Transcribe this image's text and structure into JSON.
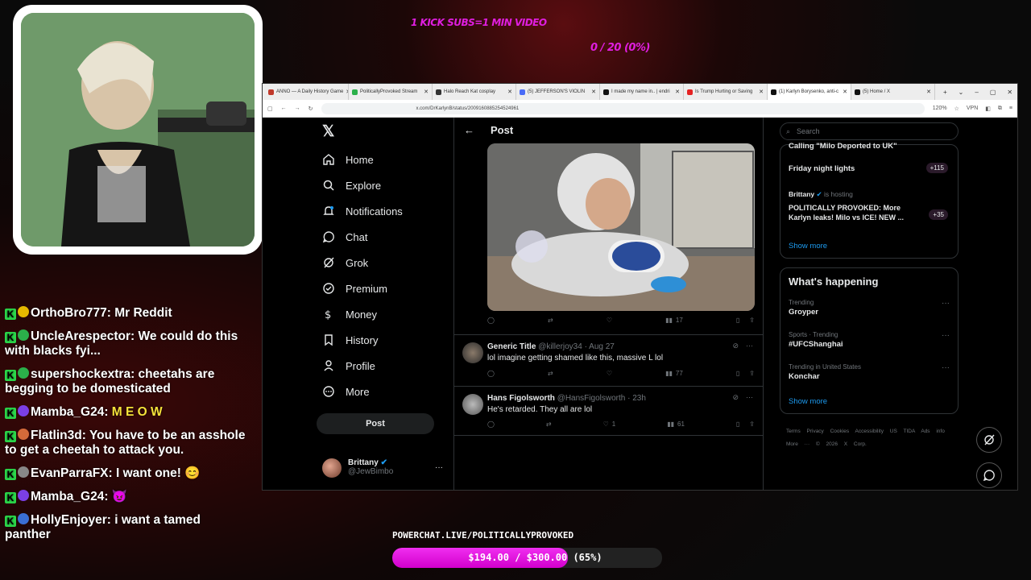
{
  "overlay": {
    "kick_subs": "1 KICK SUBS=1 MIN VIDEO",
    "sub_progress": "0 / 20 (0%)",
    "powerchat_label": "POWERCHAT.LIVE/POLITICALLYPROVOKED",
    "goal_text": "$194.00 / $300.00 (65%)",
    "goal_fraction": 0.65
  },
  "chat": [
    {
      "user": "OrthoBro777",
      "text": "Mr Reddit",
      "badge_color": "#e6b800"
    },
    {
      "user": "UncleArespector",
      "text": "We could do this with blacks fyi...",
      "badge_color": "#2bb04a"
    },
    {
      "user": "supershockextra",
      "text": "cheetahs are begging to be domesticated",
      "badge_color": "#2bb04a"
    },
    {
      "user": "Mamba_G24",
      "text": "M E O W",
      "badge_color": "#7b3fe4"
    },
    {
      "user": "Flatlin3d",
      "text": "You have to be an asshole to get a cheetah to attack you.",
      "badge_color": "#d46a3a"
    },
    {
      "user": "EvanParraFX",
      "text": "I want one! 😊",
      "badge_color": "#888888"
    },
    {
      "user": "Mamba_G24",
      "text": "😈",
      "badge_color": "#7b3fe4"
    },
    {
      "user": "HollyEnjoyer",
      "text": "i want a tamed panther",
      "badge_color": "#3a6fd4"
    }
  ],
  "browser": {
    "tabs": [
      {
        "label": "ANNO — A Daily History Game",
        "color": "#c0392b"
      },
      {
        "label": "PoliticallyProvoked Stream",
        "color": "#2bb04a"
      },
      {
        "label": "Halo Reach Kat cosplay",
        "color": "#333333"
      },
      {
        "label": "(5) JEFFERSON'S VIOLIN",
        "color": "#4a6cf7"
      },
      {
        "label": "I made my name in.. | endri",
        "color": "#111111"
      },
      {
        "label": "Is Trump Hurting or Saving",
        "color": "#e52222"
      },
      {
        "label": "(1) Karlyn Borysenko, anti-c",
        "color": "#111111"
      },
      {
        "label": "(5) Home / X",
        "color": "#111111"
      }
    ],
    "url": "x.com/DrKarlynB/status/2009160885254524961",
    "zoom": "120%",
    "vpn": "VPN"
  },
  "x": {
    "nav": [
      {
        "label": "Home",
        "icon": "home-icon"
      },
      {
        "label": "Explore",
        "icon": "search-icon"
      },
      {
        "label": "Notifications",
        "icon": "bell-icon"
      },
      {
        "label": "Chat",
        "icon": "chat-icon"
      },
      {
        "label": "Grok",
        "icon": "grok-icon"
      },
      {
        "label": "Premium",
        "icon": "premium-icon"
      },
      {
        "label": "Money",
        "icon": "money-icon"
      },
      {
        "label": "History",
        "icon": "bookmark-icon"
      },
      {
        "label": "Profile",
        "icon": "profile-icon"
      },
      {
        "label": "More",
        "icon": "more-icon"
      }
    ],
    "post_button": "Post",
    "account": {
      "name": "Brittany",
      "handle": "@JewBimbo"
    },
    "timeline_title": "Post",
    "media_actions": {
      "views": "17"
    },
    "replies": [
      {
        "name": "Generic Title",
        "handle": "@killerjoy34",
        "time": "· Aug 27",
        "text": "lol imagine getting shamed like this, massive L lol",
        "likes": "",
        "views": "77"
      },
      {
        "name": "Hans Figolsworth",
        "handle": "@HansFigolsworth",
        "time": "· 23h",
        "text": "He's retarded. They all are lol",
        "likes": "1",
        "views": "61"
      }
    ],
    "search_placeholder": "Search",
    "live": {
      "partial_title": "Calling \"Milo Deported to UK\"",
      "friday": "Friday night lights",
      "friday_count": "+115",
      "host_name": "Brittany",
      "host_status": "is hosting",
      "host_title": "POLITICALLY PROVOKED: More Karlyn leaks! Milo vs ICE! NEW ...",
      "host_count": "+35",
      "show_more": "Show more"
    },
    "whats_happening": {
      "title": "What's happening",
      "trends": [
        {
          "context": "Trending",
          "name": "Groyper"
        },
        {
          "context": "Sports · Trending",
          "name": "#UFCShanghai"
        },
        {
          "context": "Trending in United States",
          "name": "Konchar"
        }
      ],
      "show_more": "Show more"
    },
    "footer": "Terms  Privacy  Cookies  Accessibility  US TIDA  Ads info  More ···  © 2026 X Corp."
  }
}
